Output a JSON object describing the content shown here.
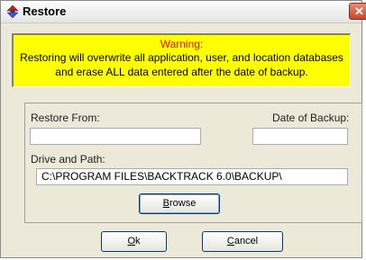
{
  "window": {
    "title": "Restore"
  },
  "warning": {
    "title": "Warning:",
    "line1": "Restoring will overwrite all application, user, and location databases",
    "line2": "and erase ALL data entered after the date of backup."
  },
  "form": {
    "restore_from_label": "Restore From:",
    "restore_from_value": "",
    "date_label": "Date of Backup:",
    "date_value": "",
    "drive_label": "Drive and Path:",
    "drive_value": "C:\\PROGRAM FILES\\BACKTRACK 6.0\\BACKUP\\"
  },
  "buttons": {
    "browse_mn": "B",
    "browse_rest": "rowse",
    "ok_mn": "O",
    "ok_rest": "k",
    "cancel_mn": "C",
    "cancel_rest": "ancel"
  },
  "colors": {
    "warning_bg": "#ffff00",
    "warning_title": "#e01010",
    "window_bg": "#ece9d8"
  },
  "icons": {
    "title": "restore-arrows-icon",
    "close": "close-icon"
  }
}
